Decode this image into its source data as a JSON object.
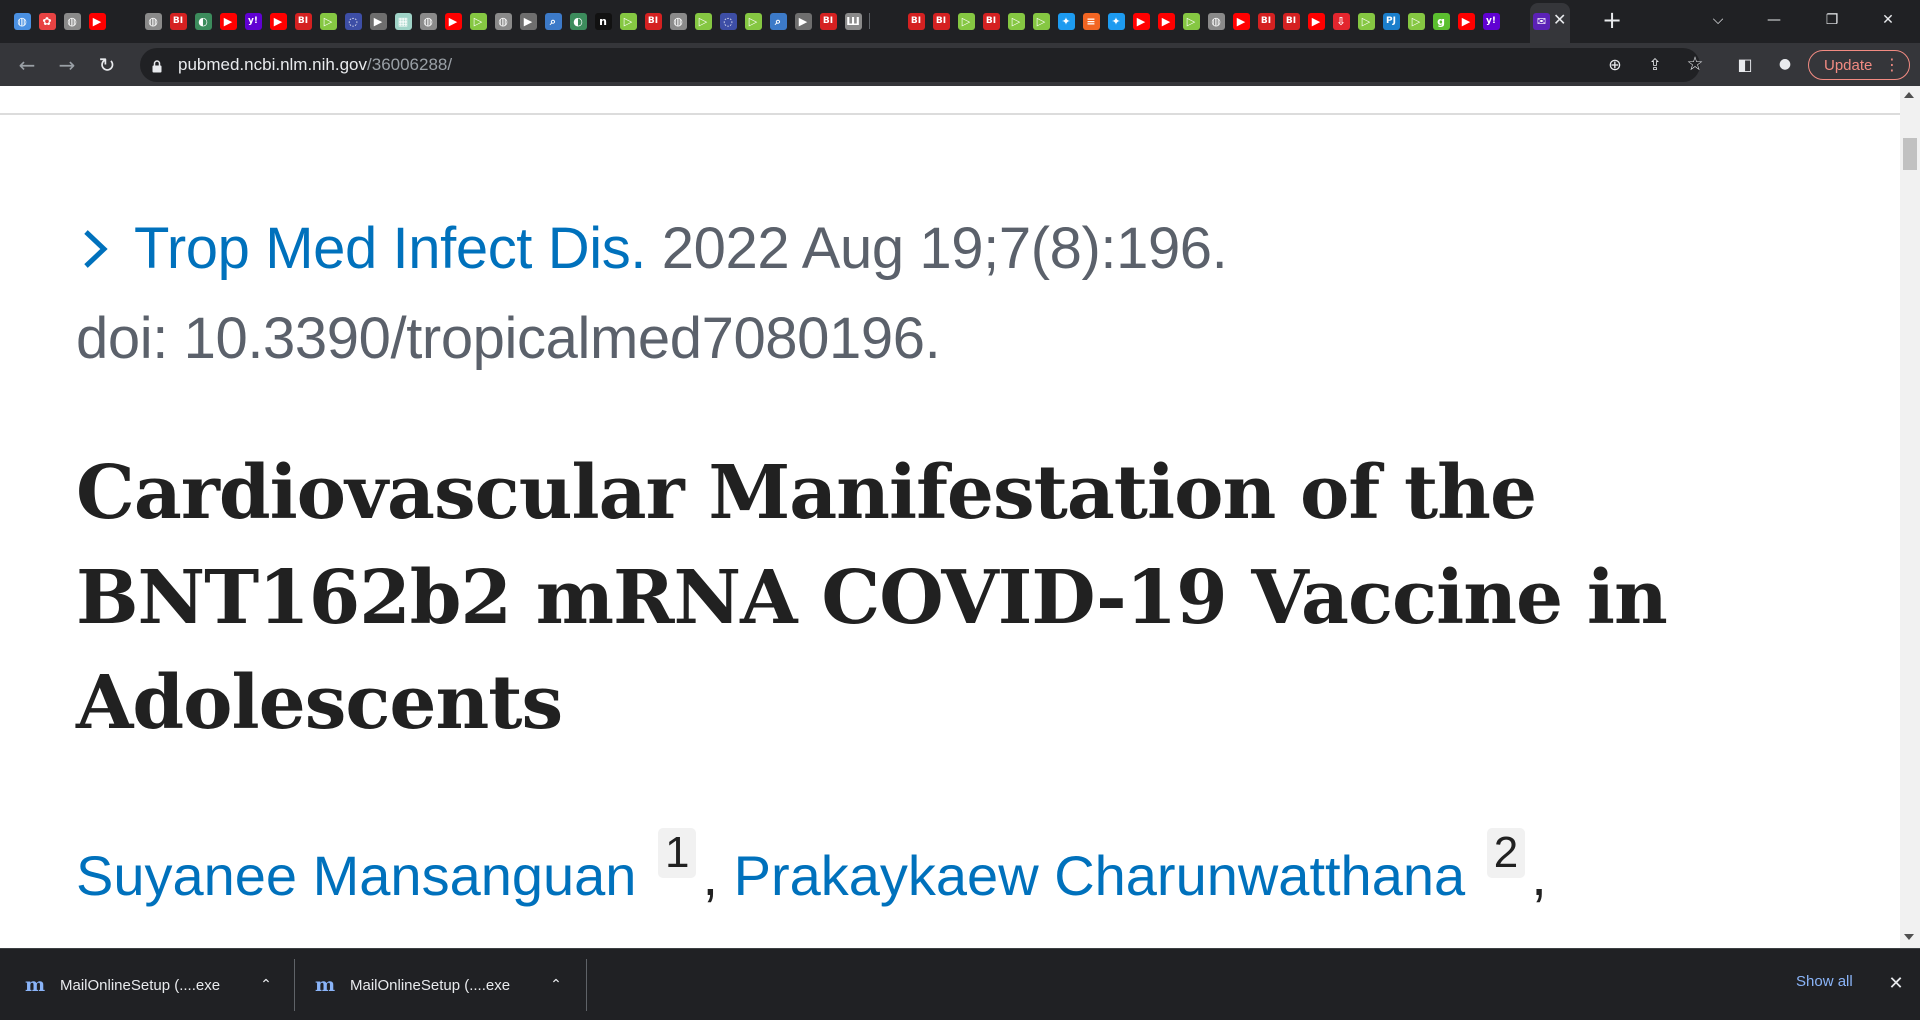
{
  "browser": {
    "tabs": {
      "favicons": [
        {
          "icon": "world-icon",
          "color": "#4a90e2",
          "glyph": "◍"
        },
        {
          "icon": "pinwheel-icon",
          "color": "#e84343",
          "glyph": "✿"
        },
        {
          "icon": "globe-icon",
          "color": "#8a8a8a",
          "glyph": "◍"
        },
        {
          "icon": "youtube-icon",
          "color": "#ff0000",
          "glyph": "▶"
        },
        {
          "icon": "gap",
          "color": "transparent",
          "glyph": ""
        },
        {
          "icon": "globe-icon",
          "color": "#8a8a8a",
          "glyph": "◍"
        },
        {
          "icon": "business-insider-icon",
          "color": "#d52121",
          "glyph": "BI"
        },
        {
          "icon": "lens-icon",
          "color": "#3c8c5c",
          "glyph": "◐"
        },
        {
          "icon": "youtube-icon",
          "color": "#ff0000",
          "glyph": "▶"
        },
        {
          "icon": "yahoo-icon",
          "color": "#6001d2",
          "glyph": "y!"
        },
        {
          "icon": "youtube-icon",
          "color": "#ff0000",
          "glyph": "▶"
        },
        {
          "icon": "business-insider-icon",
          "color": "#d52121",
          "glyph": "BI"
        },
        {
          "icon": "rumble-icon",
          "color": "#85c742",
          "glyph": "▷"
        },
        {
          "icon": "shield-icon",
          "color": "#3d4ea6",
          "glyph": "◌"
        },
        {
          "icon": "play-forward-icon",
          "color": "#6e6e6e",
          "glyph": "▶"
        },
        {
          "icon": "map-icon",
          "color": "#9fd3c7",
          "glyph": "▦"
        },
        {
          "icon": "globe-icon",
          "color": "#8a8a8a",
          "glyph": "◍"
        },
        {
          "icon": "youtube-icon",
          "color": "#ff0000",
          "glyph": "▶"
        },
        {
          "icon": "rumble-icon",
          "color": "#85c742",
          "glyph": "▷"
        },
        {
          "icon": "globe-icon",
          "color": "#8a8a8a",
          "glyph": "◍"
        },
        {
          "icon": "play-forward-icon",
          "color": "#6e6e6e",
          "glyph": "▶"
        },
        {
          "icon": "search-icon",
          "color": "#3c7ac8",
          "glyph": "⌕"
        },
        {
          "icon": "lens-icon",
          "color": "#3c8c5c",
          "glyph": "◐"
        },
        {
          "icon": "n-icon",
          "color": "#111111",
          "glyph": "n"
        },
        {
          "icon": "rumble-icon",
          "color": "#85c742",
          "glyph": "▷"
        },
        {
          "icon": "business-insider-icon",
          "color": "#d52121",
          "glyph": "BI"
        },
        {
          "icon": "globe-icon",
          "color": "#8a8a8a",
          "glyph": "◍"
        },
        {
          "icon": "rumble-icon",
          "color": "#85c742",
          "glyph": "▷"
        },
        {
          "icon": "shield-icon",
          "color": "#3d4ea6",
          "glyph": "◌"
        },
        {
          "icon": "rumble-icon",
          "color": "#85c742",
          "glyph": "▷"
        },
        {
          "icon": "search-icon",
          "color": "#3c7ac8",
          "glyph": "⌕"
        },
        {
          "icon": "play-forward-icon",
          "color": "#6e6e6e",
          "glyph": "▶"
        },
        {
          "icon": "business-insider-icon",
          "color": "#d52121",
          "glyph": "BI"
        },
        {
          "icon": "document-icon",
          "color": "#8a8a8a",
          "glyph": "Ш"
        },
        {
          "icon": "separator",
          "color": "transparent",
          "glyph": ""
        },
        {
          "icon": "gap",
          "color": "transparent",
          "glyph": ""
        },
        {
          "icon": "business-insider-icon",
          "color": "#d52121",
          "glyph": "BI"
        },
        {
          "icon": "business-insider-icon",
          "color": "#d52121",
          "glyph": "BI"
        },
        {
          "icon": "rumble-icon",
          "color": "#85c742",
          "glyph": "▷"
        },
        {
          "icon": "business-insider-icon",
          "color": "#d52121",
          "glyph": "BI"
        },
        {
          "icon": "rumble-icon",
          "color": "#85c742",
          "glyph": "▷"
        },
        {
          "icon": "rumble-icon",
          "color": "#85c742",
          "glyph": "▷"
        },
        {
          "icon": "twitter-icon",
          "color": "#1d9bf0",
          "glyph": "✦"
        },
        {
          "icon": "bookmark-icon",
          "color": "#f26522",
          "glyph": "≡"
        },
        {
          "icon": "twitter-icon",
          "color": "#1d9bf0",
          "glyph": "✦"
        },
        {
          "icon": "youtube-icon",
          "color": "#ff0000",
          "glyph": "▶"
        },
        {
          "icon": "youtube-icon",
          "color": "#ff0000",
          "glyph": "▶"
        },
        {
          "icon": "rumble-icon",
          "color": "#85c742",
          "glyph": "▷"
        },
        {
          "icon": "globe-icon",
          "color": "#8a8a8a",
          "glyph": "◍"
        },
        {
          "icon": "youtube-icon",
          "color": "#ff0000",
          "glyph": "▶"
        },
        {
          "icon": "business-insider-icon",
          "color": "#d52121",
          "glyph": "BI"
        },
        {
          "icon": "business-insider-icon",
          "color": "#d52121",
          "glyph": "BI"
        },
        {
          "icon": "youtube-icon",
          "color": "#ff0000",
          "glyph": "▶"
        },
        {
          "icon": "download-icon",
          "color": "#e3262e",
          "glyph": "⇩"
        },
        {
          "icon": "rumble-icon",
          "color": "#85c742",
          "glyph": "▷"
        },
        {
          "icon": "pj-icon",
          "color": "#1b7fcc",
          "glyph": "PJ"
        },
        {
          "icon": "rumble-icon",
          "color": "#85c742",
          "glyph": "▷"
        },
        {
          "icon": "g-icon",
          "color": "#5bbf2f",
          "glyph": "g"
        },
        {
          "icon": "youtube-icon",
          "color": "#ff0000",
          "glyph": "▶"
        },
        {
          "icon": "yahoo-icon",
          "color": "#6001d2",
          "glyph": "y!"
        }
      ],
      "active_tab": {
        "icon": "yahoo-mail-icon",
        "color": "#5b21b6",
        "glyph": "✉",
        "close_glyph": "✕"
      },
      "new_tab_glyph": "+"
    },
    "window_controls": {
      "dropdown": "⌵",
      "minimize": "—",
      "restore": "❐",
      "close": "✕"
    },
    "toolbar": {
      "back_glyph": "←",
      "forward_glyph": "→",
      "reload_glyph": "↻",
      "url_host": "pubmed.ncbi.nlm.nih.gov",
      "url_path": "/36006288/",
      "zoom_glyph": "⊕",
      "share_glyph": "⇪",
      "star_glyph": "☆",
      "sidepanel_glyph": "◧",
      "profile_glyph": "●",
      "update_label": "Update",
      "menu_glyph": "⋮"
    }
  },
  "article": {
    "journal": "Trop Med Infect Dis.",
    "citation_details": "2022 Aug 19;7(8):196.",
    "doi": "doi: 10.3390/tropicalmed7080196.",
    "title": "Cardiovascular Manifestation of the BNT162b2 mRNA COVID-19 Vaccine in Adolescents",
    "authors": [
      {
        "name": "Suyanee Mansanguan",
        "affiliation": "1"
      },
      {
        "name": "Prakaykaew Charunwatthana",
        "affiliation": "2"
      }
    ],
    "separator": ","
  },
  "downloads": {
    "items": [
      {
        "icon": "mailonline-icon",
        "glyph": "m",
        "name": "MailOnlineSetup (....exe",
        "caret": "⌃"
      },
      {
        "icon": "mailonline-icon",
        "glyph": "m",
        "name": "MailOnlineSetup (....exe",
        "caret": "⌃"
      }
    ],
    "show_all_label": "Show all",
    "close_glyph": "✕"
  },
  "colors": {
    "link_blue": "#0071bc",
    "citation_gray": "#5b616b",
    "title_dark": "#212121",
    "chrome_dark": "#202124",
    "chrome_toolbar": "#35363a",
    "update_accent": "#f28b82",
    "download_link": "#8ab4f8"
  }
}
